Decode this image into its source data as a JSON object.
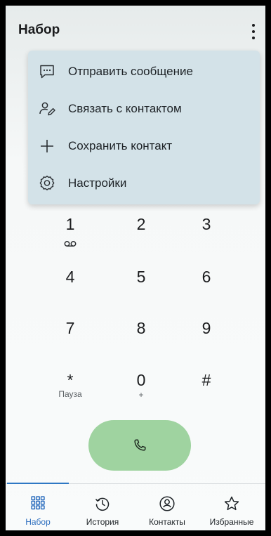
{
  "app_bar": {
    "title": "Набор",
    "more_icon": "more-vert-icon"
  },
  "menu": {
    "items": [
      {
        "label": "Отправить сообщение",
        "icon": "message-icon"
      },
      {
        "label": "Связать с контактом",
        "icon": "link-contact-icon"
      },
      {
        "label": "Сохранить контакт",
        "icon": "plus-icon"
      },
      {
        "label": "Настройки",
        "icon": "settings-icon"
      }
    ]
  },
  "keypad": {
    "keys": [
      {
        "digit": "1",
        "sub": ""
      },
      {
        "digit": "2",
        "sub": ""
      },
      {
        "digit": "3",
        "sub": ""
      },
      {
        "digit": "4",
        "sub": ""
      },
      {
        "digit": "5",
        "sub": ""
      },
      {
        "digit": "6",
        "sub": ""
      },
      {
        "digit": "7",
        "sub": ""
      },
      {
        "digit": "8",
        "sub": ""
      },
      {
        "digit": "9",
        "sub": ""
      },
      {
        "digit": "*",
        "sub": "Пауза"
      },
      {
        "digit": "0",
        "sub": "+"
      },
      {
        "digit": "#",
        "sub": ""
      }
    ],
    "voicemail_icon": "voicemail-icon"
  },
  "call_button": {
    "icon": "phone-icon"
  },
  "bottom_nav": {
    "items": [
      {
        "label": "Набор",
        "icon": "dialpad-icon",
        "active": true
      },
      {
        "label": "История",
        "icon": "history-icon",
        "active": false
      },
      {
        "label": "Контакты",
        "icon": "contacts-icon",
        "active": false
      },
      {
        "label": "Избранные",
        "icon": "star-icon",
        "active": false
      }
    ]
  },
  "colors": {
    "menu_bg": "#d3e2e8",
    "call_button_bg": "#9fd3a0",
    "accent": "#2e6fbf",
    "text": "#1b1c1e"
  }
}
